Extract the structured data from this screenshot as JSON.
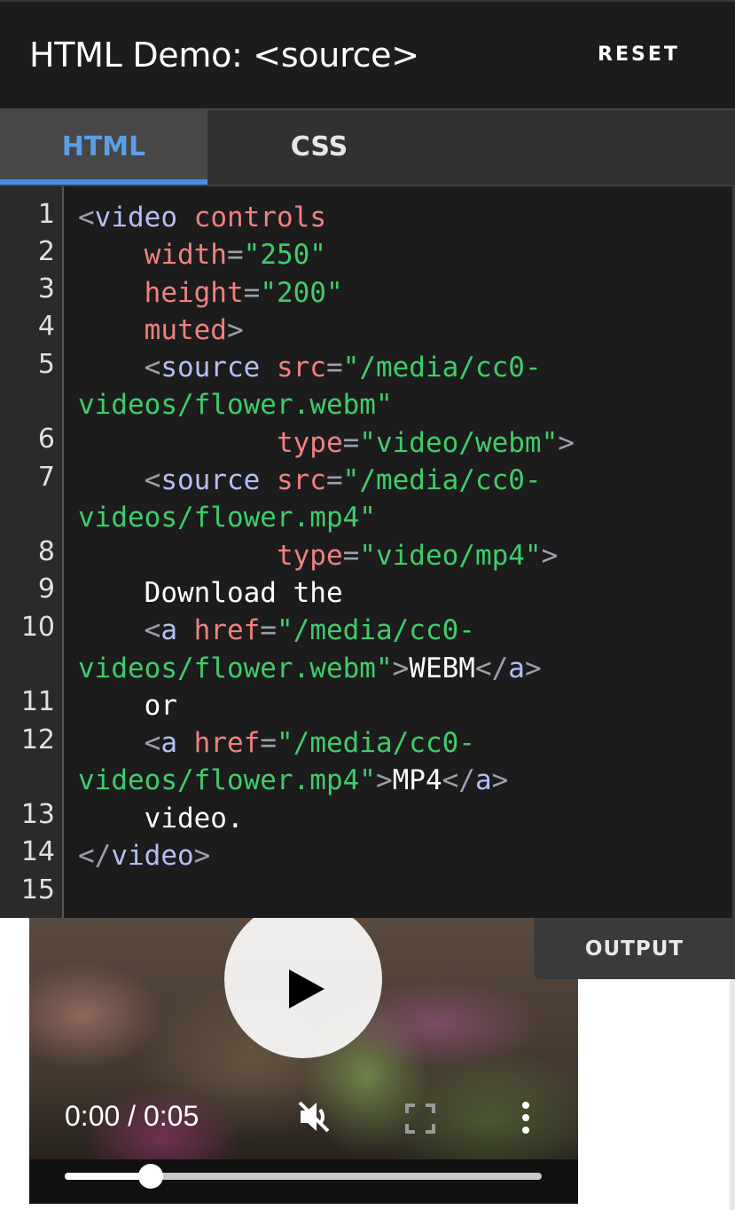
{
  "header": {
    "title": "HTML Demo: <source>",
    "reset_label": "RESET"
  },
  "tabs": [
    {
      "label": "HTML",
      "active": true
    },
    {
      "label": "CSS",
      "active": false
    }
  ],
  "editor": {
    "line_numbers": [
      "1",
      "2",
      "3",
      "4",
      "5",
      "6",
      "7",
      "8",
      "9",
      "10",
      "11",
      "12",
      "13",
      "14",
      "15"
    ]
  },
  "output": {
    "tab_label": "OUTPUT",
    "time_display": "0:00 / 0:05",
    "progress": 0.18,
    "muted": true
  },
  "icons": {
    "play": "play-icon",
    "mute": "volume-muted-icon",
    "fullscreen": "fullscreen-icon",
    "more": "more-options-icon"
  },
  "colors": {
    "accent": "#4a8de6",
    "tag": "#b4bef5",
    "attribute": "#f08080",
    "string": "#3fcc6a",
    "punctuation": "#9aa0ad"
  }
}
